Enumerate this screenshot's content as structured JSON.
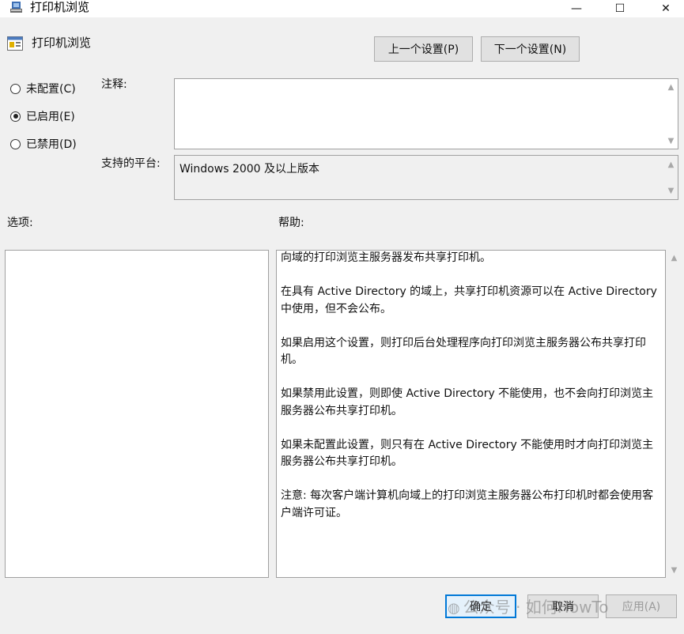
{
  "window": {
    "title": "打印机浏览",
    "minimize_symbol": "—",
    "maximize_symbol": "☐",
    "close_symbol": "✕"
  },
  "header": {
    "title": "打印机浏览",
    "prev_button": "上一个设置(P)",
    "next_button": "下一个设置(N)"
  },
  "state": {
    "options": [
      {
        "label": "未配置(C)",
        "checked": false
      },
      {
        "label": "已启用(E)",
        "checked": true
      },
      {
        "label": "已禁用(D)",
        "checked": false
      }
    ]
  },
  "comment": {
    "label": "注释:",
    "value": ""
  },
  "platform": {
    "label": "支持的平台:",
    "value": "Windows 2000 及以上版本"
  },
  "options_panel": {
    "label": "选项:"
  },
  "help_panel": {
    "label": "帮助:",
    "paragraphs": [
      "向域的打印浏览主服务器发布共享打印机。",
      "在具有 Active Directory 的域上，共享打印机资源可以在 Active Directory 中使用，但不会公布。",
      "如果启用这个设置，则打印后台处理程序向打印浏览主服务器公布共享打印机。",
      "如果禁用此设置，则即使 Active Directory 不能使用，也不会向打印浏览主服务器公布共享打印机。",
      "如果未配置此设置，则只有在 Active Directory 不能使用时才向打印浏览主服务器公布共享打印机。",
      "注意: 每次客户端计算机向域上的打印浏览主服务器公布打印机时都会使用客户端许可证。"
    ]
  },
  "footer": {
    "ok_button": "确定",
    "cancel_button": "取消",
    "apply_button": "应用(A)"
  },
  "watermark": {
    "text": "公众号 · 如何HowTo"
  },
  "colors": {
    "accent": "#0078d7",
    "background": "#f0f0f0"
  }
}
